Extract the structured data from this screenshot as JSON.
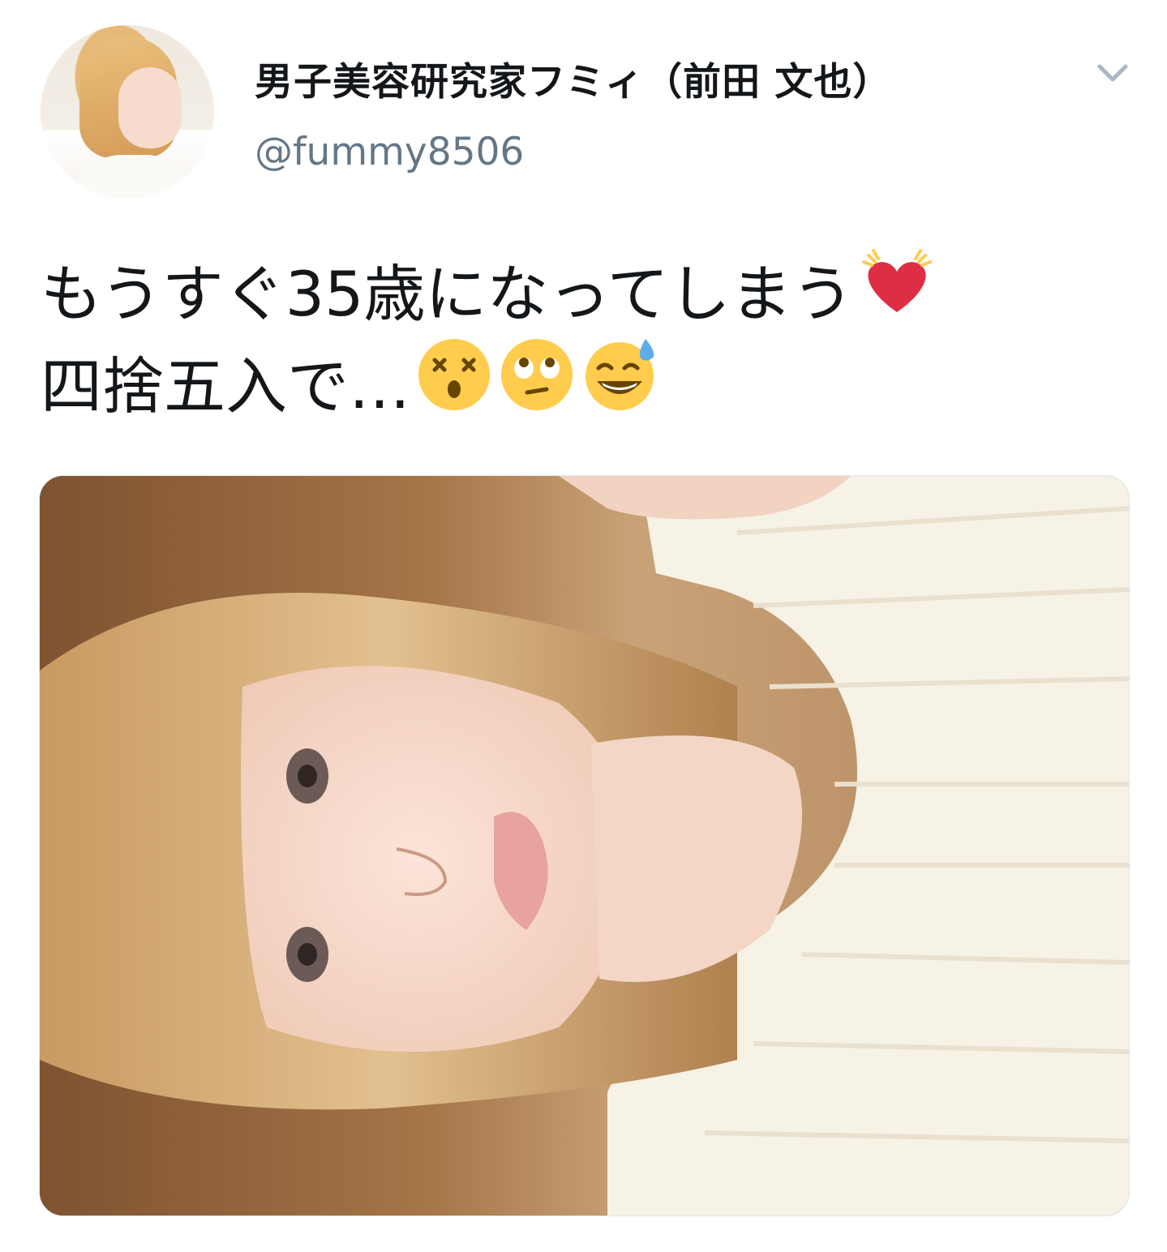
{
  "user": {
    "display_name": "男子美容研究家フミィ（前田 文也）",
    "handle": "@fummy8506"
  },
  "tweet": {
    "line1": "もうすぐ35歳になってしまう",
    "line2": "四捨五入で…",
    "emojis": [
      "beating-heart-icon",
      "dizzy-face-icon",
      "face-with-rolling-eyes-icon",
      "grinning-face-with-sweat-icon"
    ]
  },
  "colors": {
    "text": "#14171a",
    "handle": "#657786",
    "chevron": "#aab8c2",
    "heart": "#dd2e44",
    "emoji_yellow": "#ffcc4d"
  },
  "icons": {
    "menu": "chevron-down-icon"
  }
}
